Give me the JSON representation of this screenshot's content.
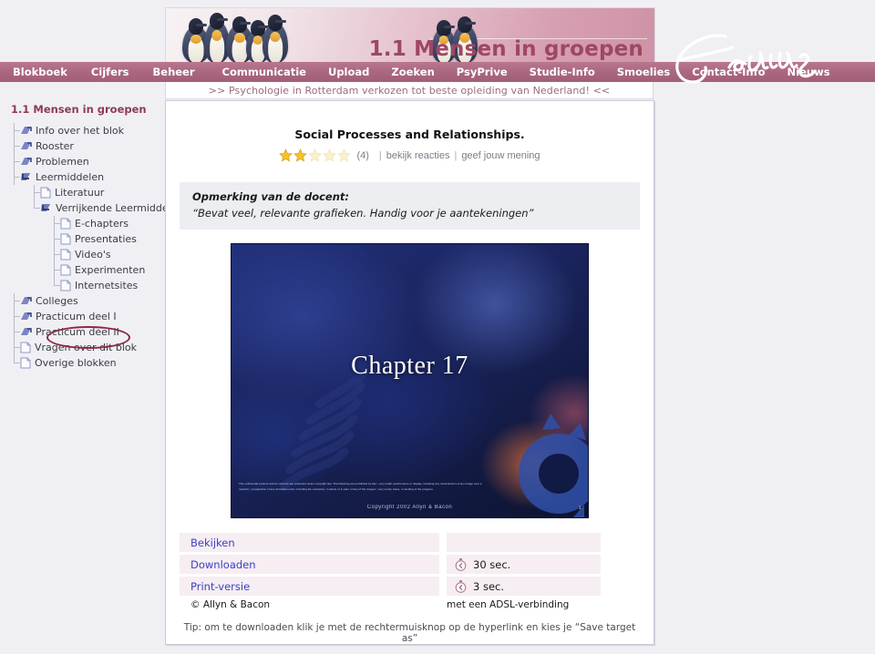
{
  "banner": {
    "title": "1.1 Mensen in groepen",
    "logo_alt": "Erasmus"
  },
  "nav": {
    "items": [
      {
        "label": "Blokboek"
      },
      {
        "label": "Cijfers"
      },
      {
        "label": "Beheer"
      },
      {
        "label": "Communicatie"
      },
      {
        "label": "Upload"
      },
      {
        "label": "Zoeken"
      },
      {
        "label": "PsyPrive"
      },
      {
        "label": "Studie-Info"
      },
      {
        "label": "Smoelies"
      },
      {
        "label": "Contact-Info"
      },
      {
        "label": "Nieuws"
      }
    ]
  },
  "ticker": {
    "text": ">> Psychologie in Rotterdam verkozen tot beste opleiding van Nederland! <<"
  },
  "sidebar": {
    "title": "1.1 Mensen in groepen",
    "items": [
      {
        "label": "Info over het blok",
        "icon": "folder-arrow-icon",
        "depth": 0,
        "type": "folder"
      },
      {
        "label": "Rooster",
        "icon": "folder-arrow-icon",
        "depth": 0,
        "type": "folder"
      },
      {
        "label": "Problemen",
        "icon": "folder-arrow-icon",
        "depth": 0,
        "type": "folder"
      },
      {
        "label": "Leermiddelen",
        "icon": "folder-arrow-open-icon",
        "depth": 0,
        "type": "folder-open"
      },
      {
        "label": "Literatuur",
        "icon": "document-icon",
        "depth": 1,
        "type": "doc"
      },
      {
        "label": "Verrijkende Leermiddelen",
        "icon": "folder-arrow-open-icon",
        "depth": 1,
        "type": "folder-open"
      },
      {
        "label": "E-chapters",
        "icon": "document-icon",
        "depth": 2,
        "type": "doc"
      },
      {
        "label": "Presentaties",
        "icon": "document-icon",
        "depth": 2,
        "type": "doc",
        "highlighted": true
      },
      {
        "label": "Video's",
        "icon": "document-icon",
        "depth": 2,
        "type": "doc"
      },
      {
        "label": "Experimenten",
        "icon": "document-icon",
        "depth": 2,
        "type": "doc"
      },
      {
        "label": "Internetsites",
        "icon": "document-icon",
        "depth": 2,
        "type": "doc"
      },
      {
        "label": "Colleges",
        "icon": "folder-arrow-icon",
        "depth": 0,
        "type": "folder"
      },
      {
        "label": "Practicum deel I",
        "icon": "folder-arrow-icon",
        "depth": 0,
        "type": "folder"
      },
      {
        "label": "Practicum deel II",
        "icon": "folder-arrow-icon",
        "depth": 0,
        "type": "folder"
      },
      {
        "label": "Vragen over dit blok",
        "icon": "document-icon",
        "depth": 0,
        "type": "doc"
      },
      {
        "label": "Overige blokken",
        "icon": "document-icon",
        "depth": 0,
        "type": "doc"
      }
    ]
  },
  "main": {
    "doc_title": "Social Processes and Relationships.",
    "rating": {
      "stars_filled": 2,
      "stars_total": 5,
      "count_label": "(4)",
      "view_reactions_label": "bekijk reacties",
      "give_opinion_label": "geef jouw mening",
      "separator": "|"
    },
    "note": {
      "heading": "Opmerking van de docent:",
      "body": "“Bevat veel, relevante grafieken. Handig voor je aantekeningen”"
    },
    "slide": {
      "title": "Chapter 17",
      "fine_print": "The multimedia product and its contents are protected under copyright law. The following are prohibited by law: • any public performance or display, including any transmission of any image over a network; • preparation of any derivative work, including the extraction, in whole or in part, of any of the images; • any rental, lease, or lending of the program.",
      "copyright": "Copyright 2002 Allyn & Bacon",
      "page_number": "1"
    },
    "actions": [
      {
        "label": "Bekijken",
        "time": "",
        "has_clock": false
      },
      {
        "label": "Downloaden",
        "time": "30 sec.",
        "has_clock": true
      },
      {
        "label": "Print-versie",
        "time": "3 sec.",
        "has_clock": true
      }
    ],
    "footer": {
      "left": "© Allyn & Bacon",
      "right": "met een ADSL-verbinding"
    },
    "tip": "Tip: om te downloaden klik je met de rechtermuisknop op de hyperlink en kies je “Save target as”"
  },
  "colors": {
    "nav_bar": "#ab6680",
    "banner_accent": "#9e4763",
    "link_blue": "#3b3fc4",
    "highlight_ring": "#8b2942",
    "action_row_bg": "#f6eef2",
    "note_bg": "#eceef2",
    "star_gold": "#f2c231",
    "star_empty": "#f7eec4",
    "page_bg": "#f0f0f4"
  }
}
